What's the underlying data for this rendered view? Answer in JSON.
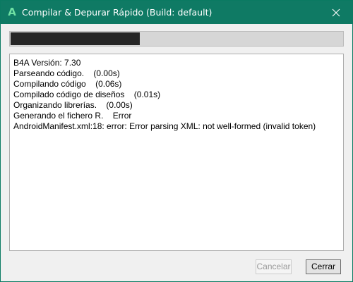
{
  "window": {
    "title": "Compilar & Depurar Rápido (Build: default)",
    "app_icon_letter": "A",
    "close_icon": "close-icon",
    "accent_color": "#0f7a64"
  },
  "progress": {
    "value_percent": 39
  },
  "log": {
    "lines": [
      "B4A Versión: 7.30",
      "Parseando código.    (0.00s)",
      "Compilando código    (0.06s)",
      "Compilado código de diseños    (0.01s)",
      "Organizando librerías.    (0.00s)",
      "Generando el fichero R.    Error",
      "AndroidManifest.xml:18: error: Error parsing XML: not well-formed (invalid token)"
    ]
  },
  "buttons": {
    "cancel_label": "Cancelar",
    "close_label": "Cerrar"
  }
}
